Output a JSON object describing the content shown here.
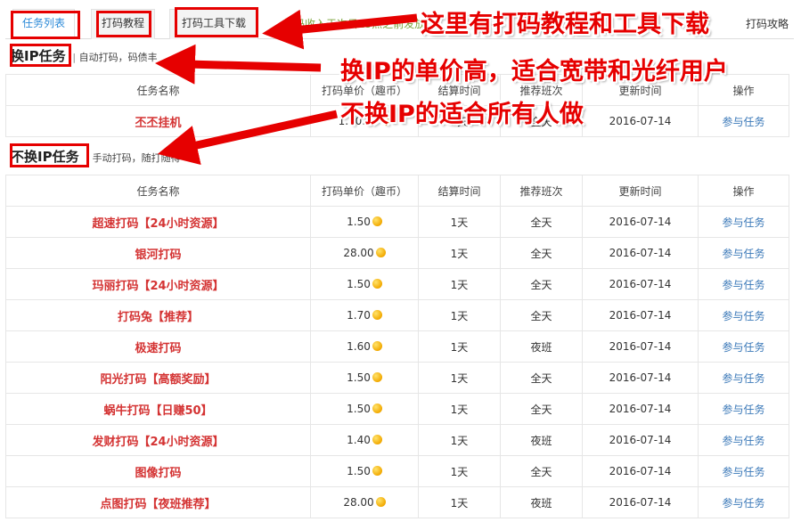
{
  "tabs": [
    {
      "label": "任务列表"
    },
    {
      "label": "打码教程"
    },
    {
      "label": "打码工具下载"
    }
  ],
  "notice": "打码收入于次日15点之前发放",
  "strategy_link": "打码攻略",
  "section_ip": {
    "title": "换IP任务",
    "subtitle": "自动打码，码债丰"
  },
  "section_noip": {
    "title": "不换IP任务",
    "subtitle": "手动打码，随打随得"
  },
  "columns": [
    "任务名称",
    "打码单价（趣币）",
    "结算时间",
    "推荐班次",
    "更新时间",
    "操作"
  ],
  "ip_tasks": [
    {
      "name": "丕丕挂机",
      "price": "1.50.00",
      "settle": "1天",
      "shift": "全天",
      "updated": "2016-07-14",
      "action": "参与任务"
    }
  ],
  "noip_tasks": [
    {
      "name": "超速打码【24小时资源】",
      "price": "1.50",
      "settle": "1天",
      "shift": "全天",
      "updated": "2016-07-14",
      "action": "参与任务"
    },
    {
      "name": "银河打码",
      "price": "28.00",
      "settle": "1天",
      "shift": "全天",
      "updated": "2016-07-14",
      "action": "参与任务"
    },
    {
      "name": "玛丽打码【24小时资源】",
      "price": "1.50",
      "settle": "1天",
      "shift": "全天",
      "updated": "2016-07-14",
      "action": "参与任务"
    },
    {
      "name": "打码兔【推荐】",
      "price": "1.70",
      "settle": "1天",
      "shift": "全天",
      "updated": "2016-07-14",
      "action": "参与任务"
    },
    {
      "name": "极速打码",
      "price": "1.60",
      "settle": "1天",
      "shift": "夜班",
      "updated": "2016-07-14",
      "action": "参与任务"
    },
    {
      "name": "阳光打码【高额奖励】",
      "price": "1.50",
      "settle": "1天",
      "shift": "全天",
      "updated": "2016-07-14",
      "action": "参与任务"
    },
    {
      "name": "蜗牛打码【日赚50】",
      "price": "1.50",
      "settle": "1天",
      "shift": "全天",
      "updated": "2016-07-14",
      "action": "参与任务"
    },
    {
      "name": "发财打码【24小时资源】",
      "price": "1.40",
      "settle": "1天",
      "shift": "夜班",
      "updated": "2016-07-14",
      "action": "参与任务"
    },
    {
      "name": "图像打码",
      "price": "1.50",
      "settle": "1天",
      "shift": "全天",
      "updated": "2016-07-14",
      "action": "参与任务"
    },
    {
      "name": "点图打码【夜班推荐】",
      "price": "28.00",
      "settle": "1天",
      "shift": "夜班",
      "updated": "2016-07-14",
      "action": "参与任务"
    }
  ],
  "annotations": {
    "tutorial": "这里有打码教程和工具下载",
    "ip": "换IP的单价高，适合宽带和光纤用户",
    "noip": "不换IP的适合所有人做"
  },
  "annotation_color": "#e60000",
  "coin_icon": "gold-coin-icon"
}
